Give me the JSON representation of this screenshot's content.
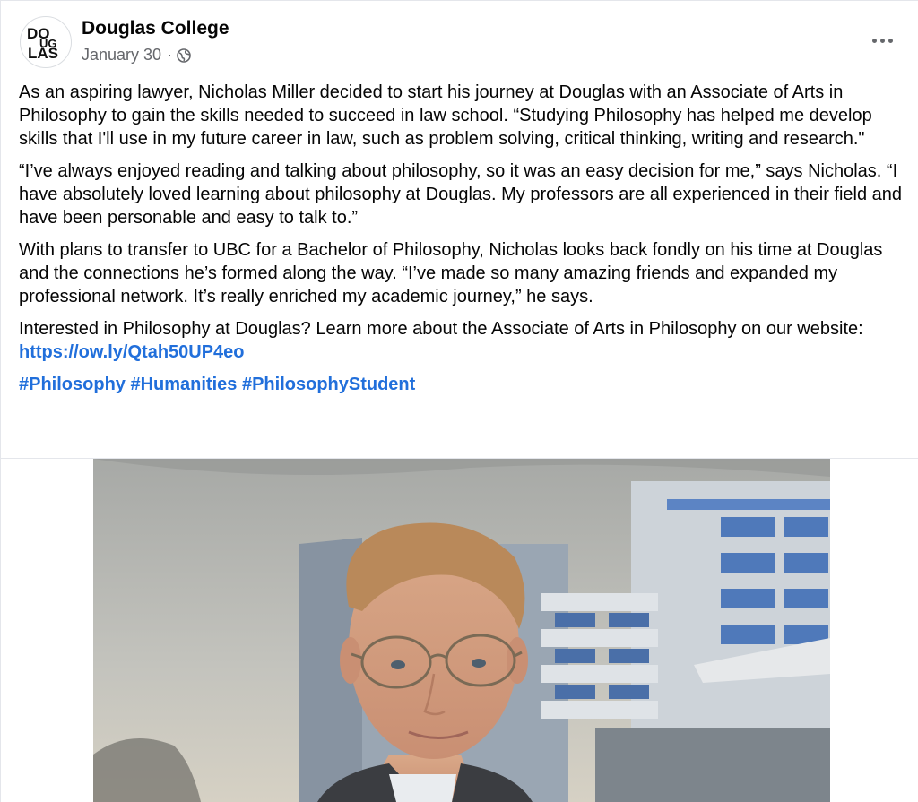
{
  "post": {
    "page_name": "Douglas College",
    "date": "January 30",
    "separator": "·",
    "avatar_logo_text": "DOUGLAS",
    "icons": {
      "privacy": "globe-icon",
      "options": "more-options-icon"
    },
    "paragraphs": [
      "As an aspiring lawyer, Nicholas Miller decided to start his journey at Douglas with an Associate of Arts in Philosophy to gain the skills needed to succeed in law school.  “Studying Philosophy has helped me develop skills that I'll use in my future career in law, such as problem solving, critical thinking, writing and research.\"",
      "“I’ve always enjoyed reading and talking about philosophy, so it was an easy decision for me,” says Nicholas. “I have absolutely loved learning about philosophy at Douglas. My professors are all experienced in their field and have been personable and easy to talk to.”",
      "With plans to transfer to UBC for a Bachelor of Philosophy, Nicholas looks back fondly on his time at Douglas and the connections he’s formed along the way. “I’ve made so many amazing friends and expanded my professional network. It’s really enriched my academic journey,” he says."
    ],
    "cta_text": "Interested in Philosophy at Douglas? Learn more about the Associate of Arts in Philosophy on our website: ",
    "cta_link": "https://ow.ly/Qtah50UP4eo",
    "hashtags": [
      "#Philosophy",
      "#Humanities",
      "#PhilosophyStudent"
    ],
    "colors": {
      "link": "#216fdb",
      "secondary_text": "#65676b",
      "primary_text": "#050505"
    }
  }
}
